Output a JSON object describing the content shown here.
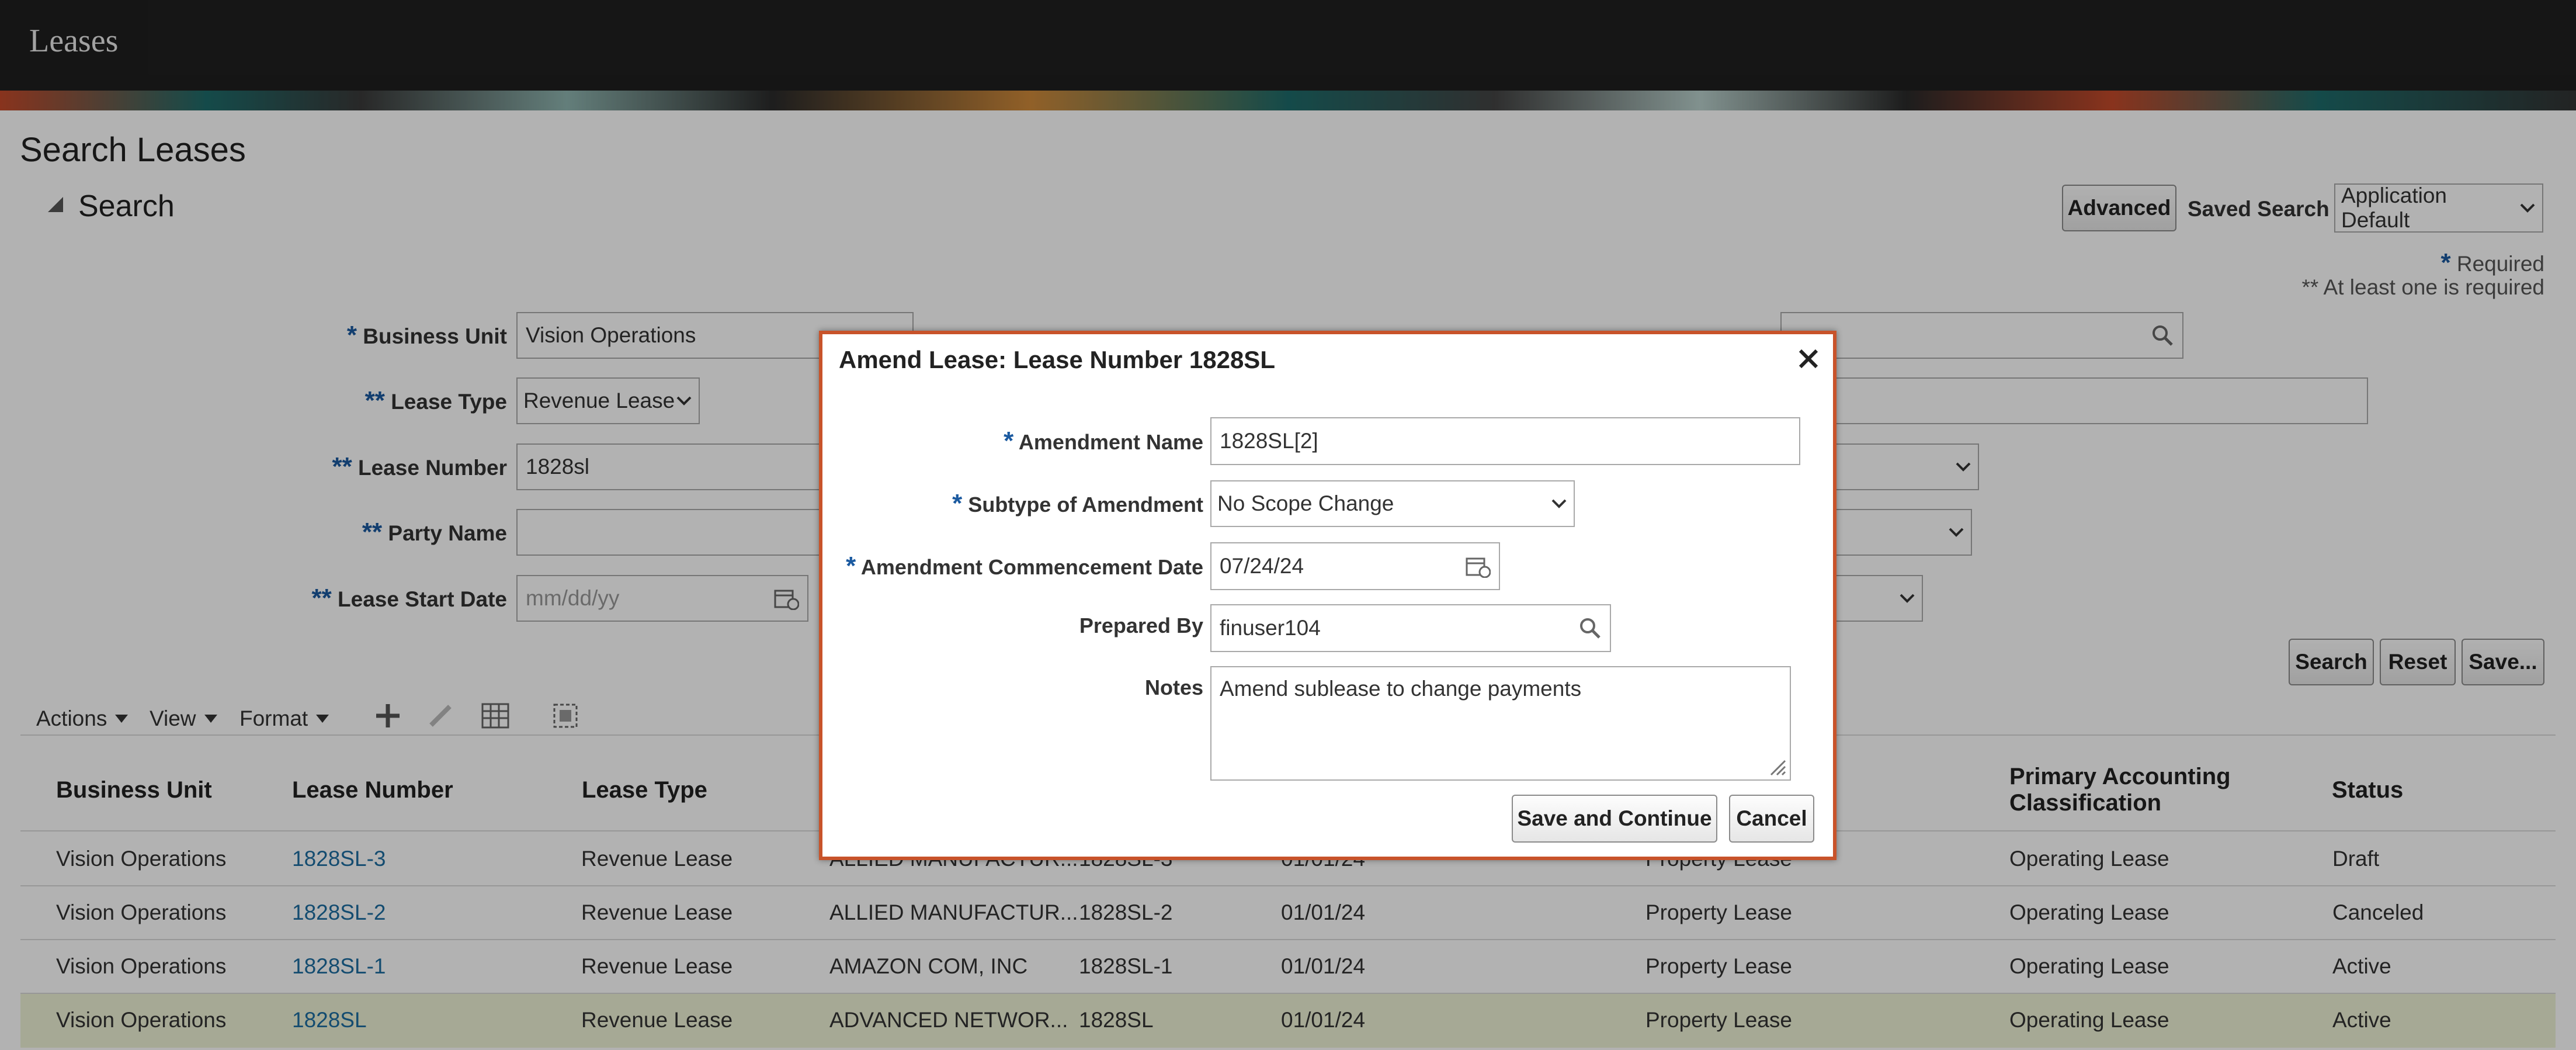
{
  "app": {
    "title": "Leases"
  },
  "page": {
    "title": "Search Leases"
  },
  "search": {
    "section_title": "Search",
    "advanced_label": "Advanced",
    "saved_search_label": "Saved Search",
    "saved_search_value": "Application Default",
    "required_note": "Required",
    "at_least_one_note": "** At least one is required",
    "fields": {
      "business_unit": {
        "label": "Business Unit",
        "value": "Vision Operations"
      },
      "lease_type": {
        "label": "Lease Type",
        "value": "Revenue Lease"
      },
      "lease_number": {
        "label": "Lease Number",
        "value": "1828sl"
      },
      "party_name": {
        "label": "Party Name",
        "value": ""
      },
      "lease_start_date": {
        "label": "Lease Start Date",
        "placeholder": "mm/dd/yy"
      }
    },
    "search_button": "Search",
    "reset_button": "Reset",
    "save_button": "Save..."
  },
  "toolbar": {
    "actions": "Actions",
    "view": "View",
    "format": "Format"
  },
  "table": {
    "columns": [
      "Business Unit",
      "Lease Number",
      "Lease Type",
      "Primary Accounting",
      "Classification",
      "Status"
    ],
    "rows": [
      {
        "bu": "Vision Operations",
        "number": "1828SL-3",
        "type": "Revenue Lease",
        "party": "ALLIED MANUFACTUR...",
        "ref": "1828SL-3",
        "date": "01/01/24",
        "class": "Property Lease",
        "acct": "Operating Lease",
        "status": "Draft"
      },
      {
        "bu": "Vision Operations",
        "number": "1828SL-2",
        "type": "Revenue Lease",
        "party": "ALLIED MANUFACTUR...",
        "ref": "1828SL-2",
        "date": "01/01/24",
        "class": "Property Lease",
        "acct": "Operating Lease",
        "status": "Canceled"
      },
      {
        "bu": "Vision Operations",
        "number": "1828SL-1",
        "type": "Revenue Lease",
        "party": "AMAZON COM, INC",
        "ref": "1828SL-1",
        "date": "01/01/24",
        "class": "Property Lease",
        "acct": "Operating Lease",
        "status": "Active"
      },
      {
        "bu": "Vision Operations",
        "number": "1828SL",
        "type": "Revenue Lease",
        "party": "ADVANCED NETWOR...",
        "ref": "1828SL",
        "date": "01/01/24",
        "class": "Property Lease",
        "acct": "Operating Lease",
        "status": "Active"
      }
    ]
  },
  "dialog": {
    "title": "Amend Lease: Lease Number 1828SL",
    "amendment_name": {
      "label": "Amendment Name",
      "value": "1828SL[2]"
    },
    "subtype": {
      "label": "Subtype of Amendment",
      "value": "No Scope Change"
    },
    "commencement_date": {
      "label": "Amendment Commencement Date",
      "value": "07/24/24"
    },
    "prepared_by": {
      "label": "Prepared By",
      "value": "finuser104"
    },
    "notes": {
      "label": "Notes",
      "value": "Amend sublease to change payments"
    },
    "save_continue": "Save and Continue",
    "cancel": "Cancel"
  },
  "colors": {
    "accent": "#c8532a",
    "link": "#1e6ea1",
    "required": "#1b5aa0"
  }
}
